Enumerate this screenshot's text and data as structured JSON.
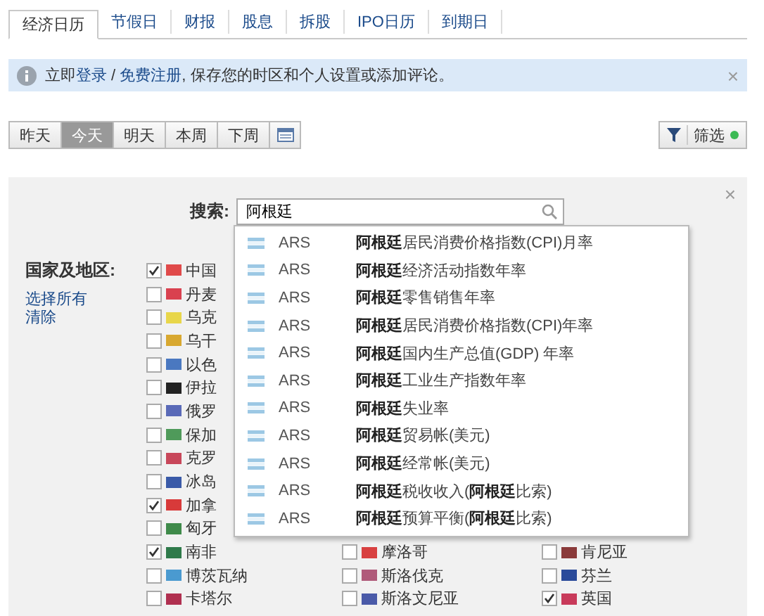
{
  "tabs": [
    {
      "label": "经济日历",
      "selected": true
    },
    {
      "label": "节假日",
      "selected": false
    },
    {
      "label": "财报",
      "selected": false
    },
    {
      "label": "股息",
      "selected": false
    },
    {
      "label": "拆股",
      "selected": false
    },
    {
      "label": "IPO日历",
      "selected": false
    },
    {
      "label": "到期日",
      "selected": false
    }
  ],
  "banner": {
    "prefix": "立即",
    "login": "登录",
    "sep": " / ",
    "register": "免费注册",
    "rest": ", 保存您的时区和个人设置或添加评论。",
    "close": "×"
  },
  "day_buttons": [
    {
      "label": "昨天",
      "selected": false
    },
    {
      "label": "今天",
      "selected": true
    },
    {
      "label": "明天",
      "selected": false
    },
    {
      "label": "本周",
      "selected": false
    },
    {
      "label": "下周",
      "selected": false
    }
  ],
  "filter_button": {
    "label": "筛选"
  },
  "filter_panel": {
    "close": "×",
    "search_label": "搜索:",
    "search_value": "阿根廷",
    "suggestions": [
      {
        "code": "ARS",
        "name": "**阿根廷**居民消费价格指数(CPI)月率"
      },
      {
        "code": "ARS",
        "name": "**阿根廷**经济活动指数年率"
      },
      {
        "code": "ARS",
        "name": "**阿根廷**零售销售年率"
      },
      {
        "code": "ARS",
        "name": "**阿根廷**居民消费价格指数(CPI)年率"
      },
      {
        "code": "ARS",
        "name": "**阿根廷**国内生产总值(GDP) 年率"
      },
      {
        "code": "ARS",
        "name": "**阿根廷**工业生产指数年率"
      },
      {
        "code": "ARS",
        "name": "**阿根廷**失业率"
      },
      {
        "code": "ARS",
        "name": "**阿根廷**贸易帐(美元)"
      },
      {
        "code": "ARS",
        "name": "**阿根廷**经常帐(美元)"
      },
      {
        "code": "ARS",
        "name": "**阿根廷**税收收入(**阿根廷**比索)"
      },
      {
        "code": "ARS",
        "name": "**阿根廷**预算平衡(**阿根廷**比索)"
      }
    ],
    "countries_label": "国家及地区:",
    "select_all": "选择所有",
    "clear": "清除",
    "country_rows": [
      {
        "cells": [
          {
            "name": "中国",
            "checked": true,
            "color": "#e04a4a"
          }
        ]
      },
      {
        "cells": [
          {
            "name": "丹麦",
            "checked": false,
            "color": "#d9414f"
          }
        ]
      },
      {
        "cells": [
          {
            "name": "乌克",
            "checked": false,
            "color": "#e8d64a"
          }
        ]
      },
      {
        "cells": [
          {
            "name": "乌干",
            "checked": false,
            "color": "#d8a830"
          }
        ]
      },
      {
        "cells": [
          {
            "name": "以色",
            "checked": false,
            "color": "#4a78c0"
          }
        ]
      },
      {
        "cells": [
          {
            "name": "伊拉",
            "checked": false,
            "color": "#222222"
          }
        ]
      },
      {
        "cells": [
          {
            "name": "俄罗",
            "checked": false,
            "color": "#5a6ab8"
          }
        ]
      },
      {
        "cells": [
          {
            "name": "保加",
            "checked": false,
            "color": "#4f9a5a"
          }
        ]
      },
      {
        "cells": [
          {
            "name": "克罗",
            "checked": false,
            "color": "#c8475a"
          }
        ]
      },
      {
        "cells": [
          {
            "name": "冰岛",
            "checked": false,
            "color": "#3a5aa8"
          }
        ]
      },
      {
        "cells": [
          {
            "name": "加拿",
            "checked": true,
            "color": "#d83a3a"
          }
        ]
      },
      {
        "cells": [
          {
            "name": "匈牙",
            "checked": false,
            "color": "#3f8a4a"
          }
        ]
      },
      {
        "cells": [
          {
            "name": "南非",
            "checked": true,
            "color": "#2f7a4a"
          },
          {
            "name": "摩洛哥",
            "checked": false,
            "color": "#d84040"
          },
          {
            "name": "肯尼亚",
            "checked": false,
            "color": "#8a3a3a"
          }
        ]
      },
      {
        "cells": [
          {
            "name": "博茨瓦纳",
            "checked": false,
            "color": "#4a9ad0"
          },
          {
            "name": "斯洛伐克",
            "checked": false,
            "color": "#b05a7a"
          },
          {
            "name": "芬兰",
            "checked": false,
            "color": "#2a4a9a"
          }
        ]
      },
      {
        "cells": [
          {
            "name": "卡塔尔",
            "checked": false,
            "color": "#b03050"
          },
          {
            "name": "斯洛文尼亚",
            "checked": false,
            "color": "#4a5aa8"
          },
          {
            "name": "英国",
            "checked": true,
            "color": "#c83a5a"
          }
        ]
      }
    ]
  }
}
